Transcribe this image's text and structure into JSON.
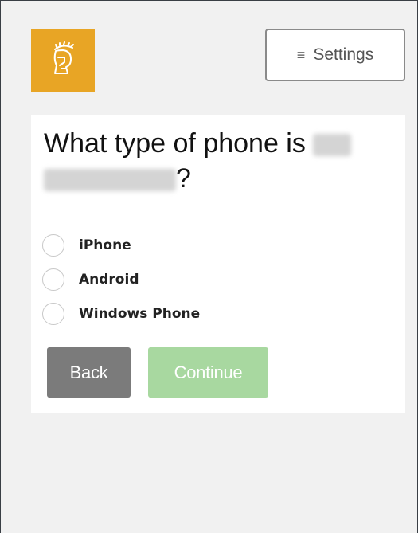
{
  "header": {
    "logo_icon": "spartan-helmet-logo-icon",
    "settings_icon": "hamburger-icon",
    "settings_label": "Settings"
  },
  "question": {
    "text_before": "What type of phone is",
    "text_after": "?"
  },
  "options": [
    {
      "label": "iPhone",
      "selected": false
    },
    {
      "label": "Android",
      "selected": false
    },
    {
      "label": "Windows Phone",
      "selected": false
    }
  ],
  "buttons": {
    "back_label": "Back",
    "continue_label": "Continue",
    "continue_disabled": true
  },
  "colors": {
    "logo_bg": "#e8a525",
    "back_bg": "#7b7b7b",
    "continue_bg": "#a8d8a0",
    "page_bg": "#f1f1f1"
  }
}
